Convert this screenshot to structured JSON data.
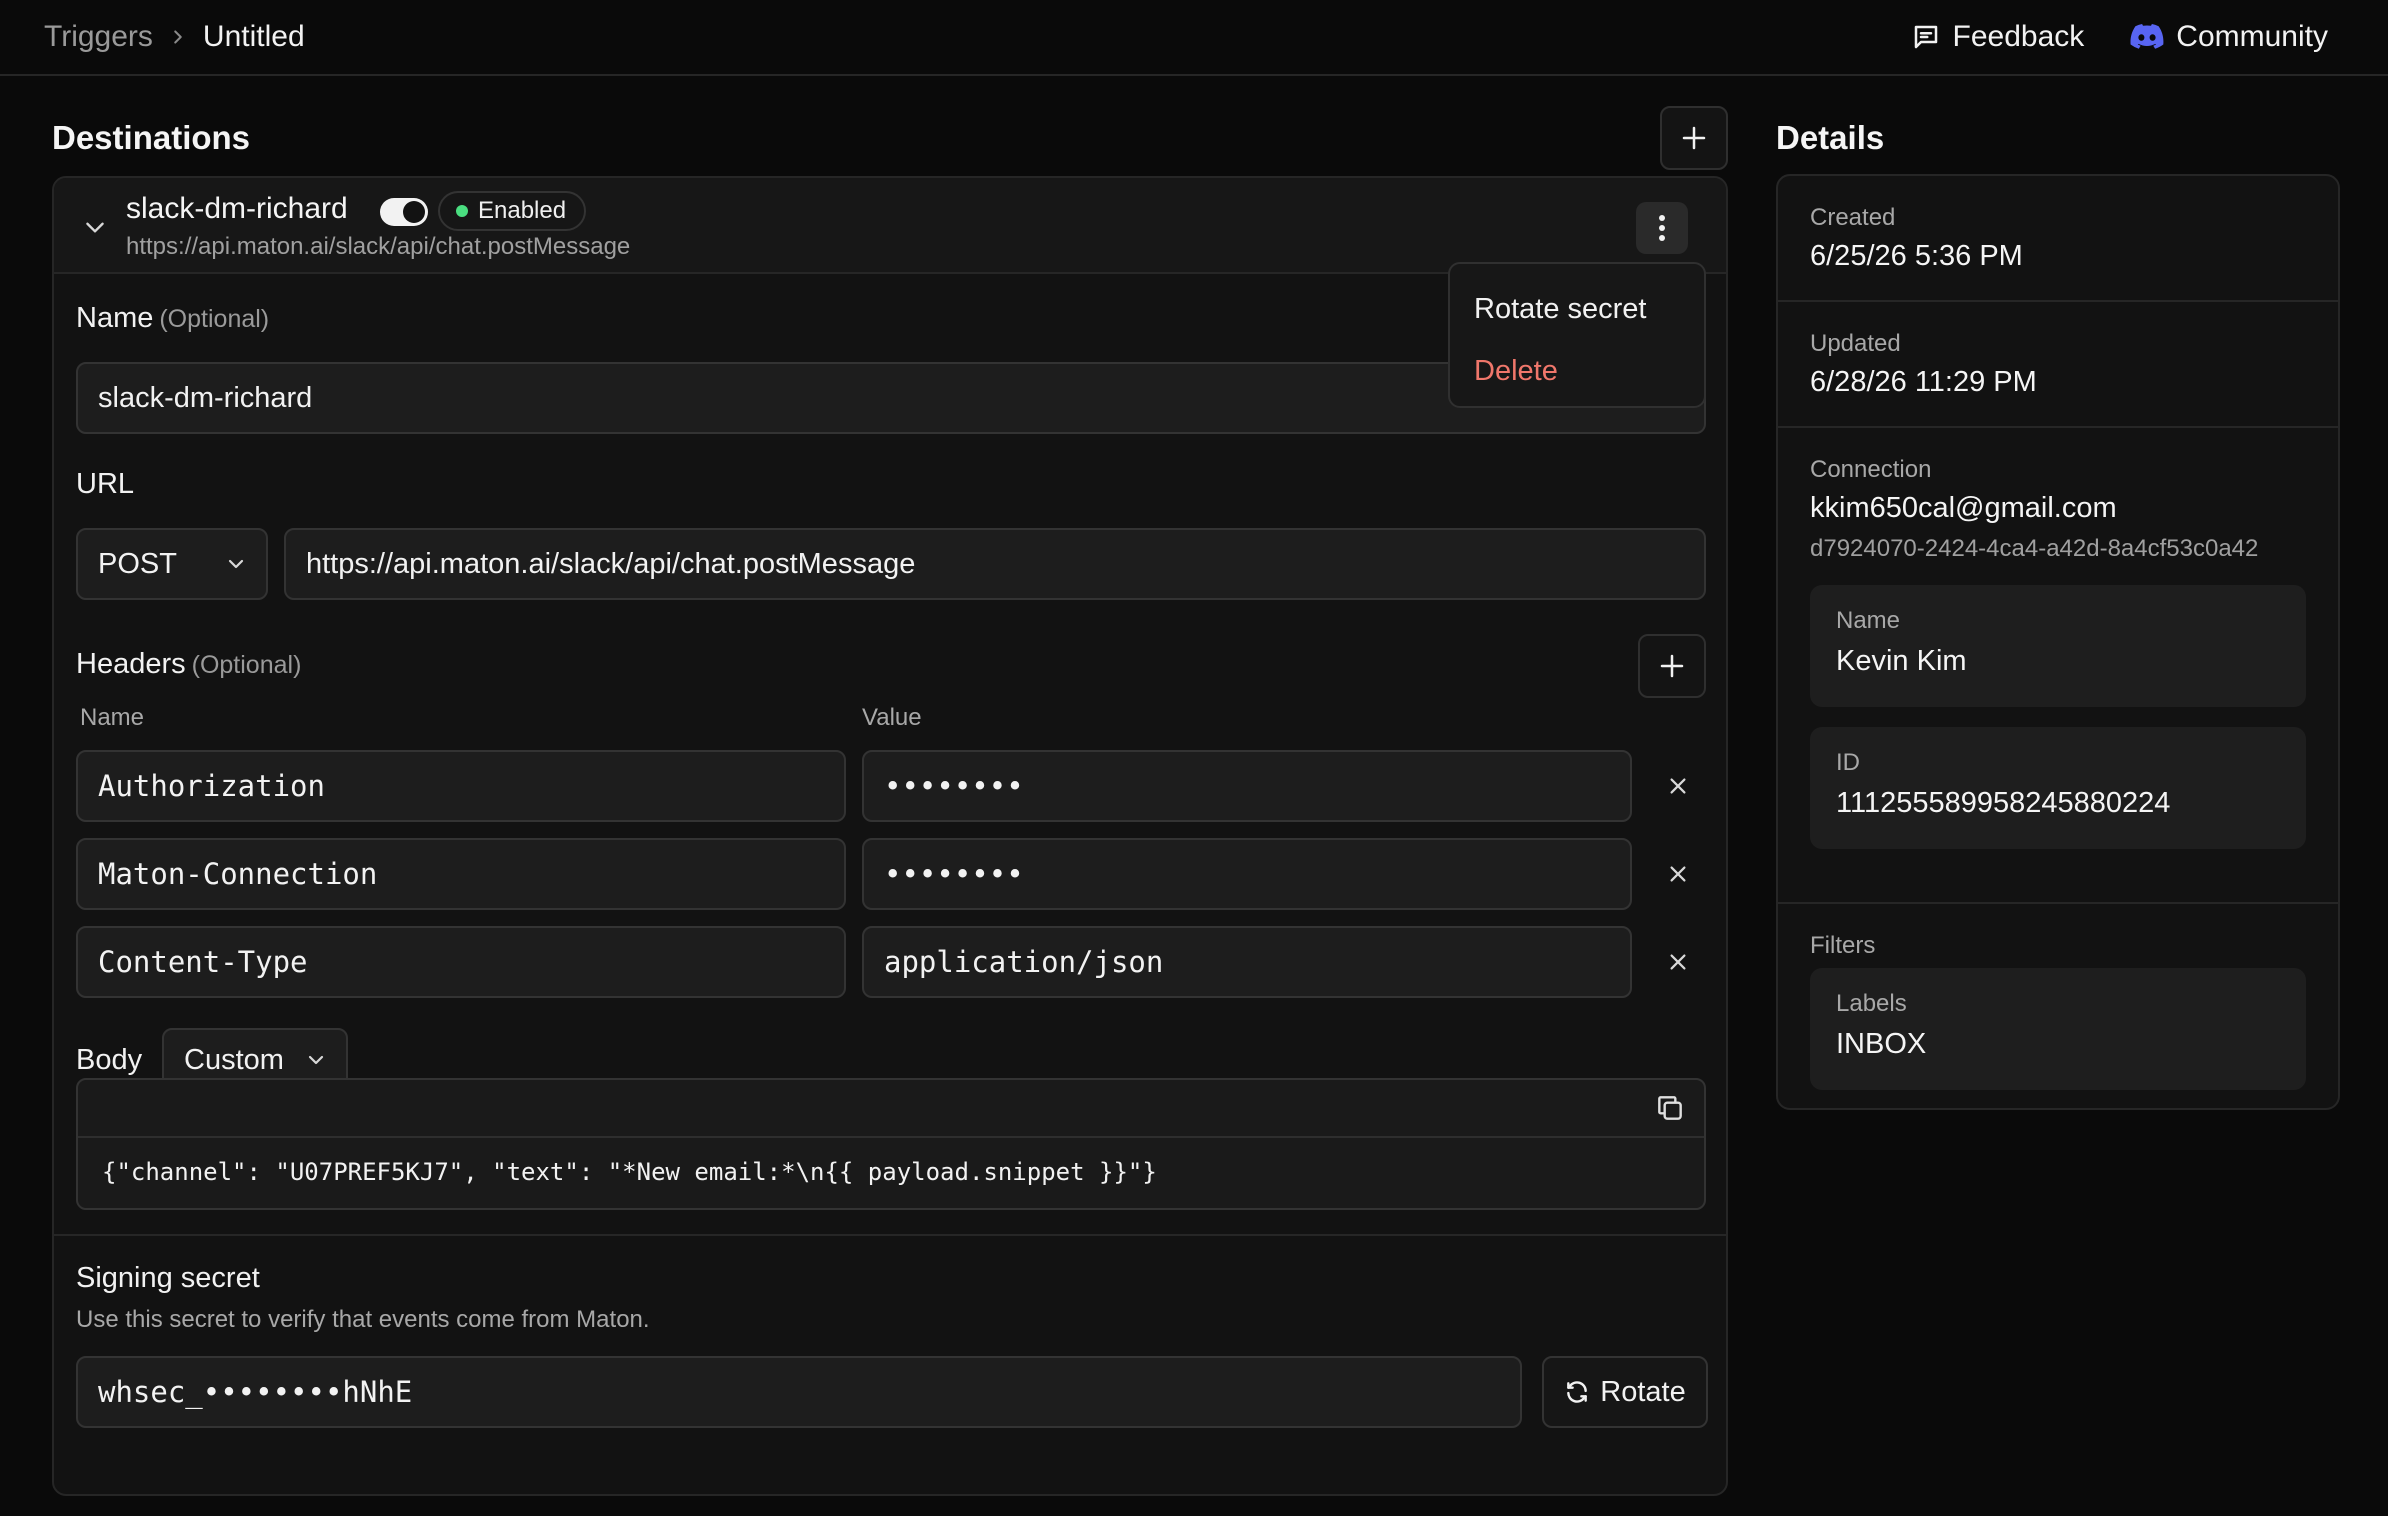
{
  "breadcrumb": {
    "parent": "Triggers",
    "current": "Untitled"
  },
  "top_actions": {
    "feedback": "Feedback",
    "community": "Community"
  },
  "destinations": {
    "title": "Destinations",
    "item": {
      "name": "slack-dm-richard",
      "url": "https://api.maton.ai/slack/api/chat.postMessage",
      "status": "Enabled",
      "menu": {
        "rotate": "Rotate secret",
        "delete": "Delete"
      },
      "form": {
        "name_label": "Name",
        "optional": "(Optional)",
        "name_value": "slack-dm-richard",
        "url_label": "URL",
        "method": "POST",
        "url_value": "https://api.maton.ai/slack/api/chat.postMessage",
        "headers_label": "Headers",
        "headers_optional": "(Optional)",
        "col_name": "Name",
        "col_value": "Value",
        "headers": [
          {
            "name": "Authorization",
            "value": "••••••••"
          },
          {
            "name": "Maton-Connection",
            "value": "••••••••"
          },
          {
            "name": "Content-Type",
            "value": "application/json"
          }
        ],
        "body_label": "Body",
        "body_type": "Custom",
        "body_code": "{\"channel\": \"U07PREF5KJ7\", \"text\": \"*New email:*\\n{{ payload.snippet }}\"}"
      },
      "signing": {
        "title": "Signing secret",
        "description": "Use this secret to verify that events come from Maton.",
        "secret": "whsec_••••••••hNhE",
        "rotate_label": "Rotate"
      }
    }
  },
  "details": {
    "title": "Details",
    "created_label": "Created",
    "created": "6/25/26 5:36 PM",
    "updated_label": "Updated",
    "updated": "6/28/26 11:29 PM",
    "connection_label": "Connection",
    "connection_email": "kkim650cal@gmail.com",
    "connection_id": "d7924070-2424-4ca4-a42d-8a4cf53c0a42",
    "name_label": "Name",
    "name": "Kevin Kim",
    "id_label": "ID",
    "id": "111255589958245880224",
    "filters_label": "Filters",
    "labels_label": "Labels",
    "labels": "INBOX"
  },
  "colors": {
    "accent_green": "#4ade80",
    "danger": "#f0776b",
    "discord": "#5865f2"
  }
}
